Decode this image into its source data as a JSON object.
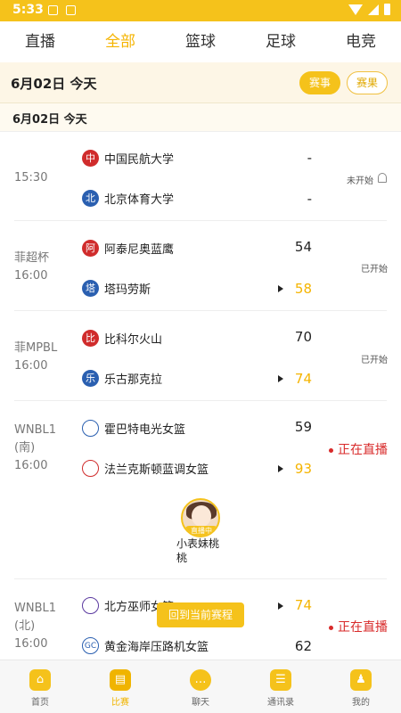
{
  "status_bar": {
    "time": "5:33"
  },
  "tabs": [
    {
      "label": "直播"
    },
    {
      "label": "全部"
    },
    {
      "label": "篮球"
    },
    {
      "label": "足球"
    },
    {
      "label": "电竞"
    }
  ],
  "date_bar": {
    "text": "6月02日  今天",
    "btn_schedule": "赛事",
    "btn_results": "赛果"
  },
  "sub_date": "6月02日  今天",
  "matches": [
    {
      "league": "",
      "time": "15:30",
      "home": {
        "logo": "中",
        "name": "中国民航大学",
        "score": "-"
      },
      "away": {
        "logo": "北",
        "name": "北京体育大学",
        "score": "-"
      },
      "status": "未开始"
    },
    {
      "league": "菲超杯",
      "time": "16:00",
      "home": {
        "logo": "阿",
        "name": "阿泰尼奥蓝鹰",
        "score": "54"
      },
      "away": {
        "logo": "塔",
        "name": "塔玛劳斯",
        "score": "58"
      },
      "status": "已开始"
    },
    {
      "league": "菲MPBL",
      "time": "16:00",
      "home": {
        "logo": "比",
        "name": "比科尔火山",
        "score": "70"
      },
      "away": {
        "logo": "乐",
        "name": "乐古那克拉",
        "score": "74"
      },
      "status": "已开始"
    },
    {
      "league": "WNBL1\n(南)",
      "time": "16:00",
      "home": {
        "logo": "",
        "name": "霍巴特电光女篮",
        "score": "59"
      },
      "away": {
        "logo": "",
        "name": "法兰克斯顿蓝调女篮",
        "score": "93"
      },
      "status": "正在直播"
    },
    {
      "league": "WNBL1\n(北)",
      "time": "16:00",
      "home": {
        "logo": "",
        "name": "北方巫师女篮",
        "score": "74"
      },
      "away": {
        "logo": "GC",
        "name": "黄金海岸压路机女篮",
        "score": "62"
      },
      "status": "正在直播"
    }
  ],
  "anchor": {
    "tag": "直播中",
    "name": "小表妹桃桃"
  },
  "toast": "回到当前赛程",
  "bottom_nav": [
    {
      "label": "首页",
      "icon": "home-icon"
    },
    {
      "label": "比赛",
      "icon": "match-icon"
    },
    {
      "label": "聊天",
      "icon": "chat-icon"
    },
    {
      "label": "通讯录",
      "icon": "contacts-icon"
    },
    {
      "label": "我的",
      "icon": "profile-icon"
    }
  ],
  "colors": {
    "accent": "#f5c21b",
    "live": "#d82a2a"
  }
}
